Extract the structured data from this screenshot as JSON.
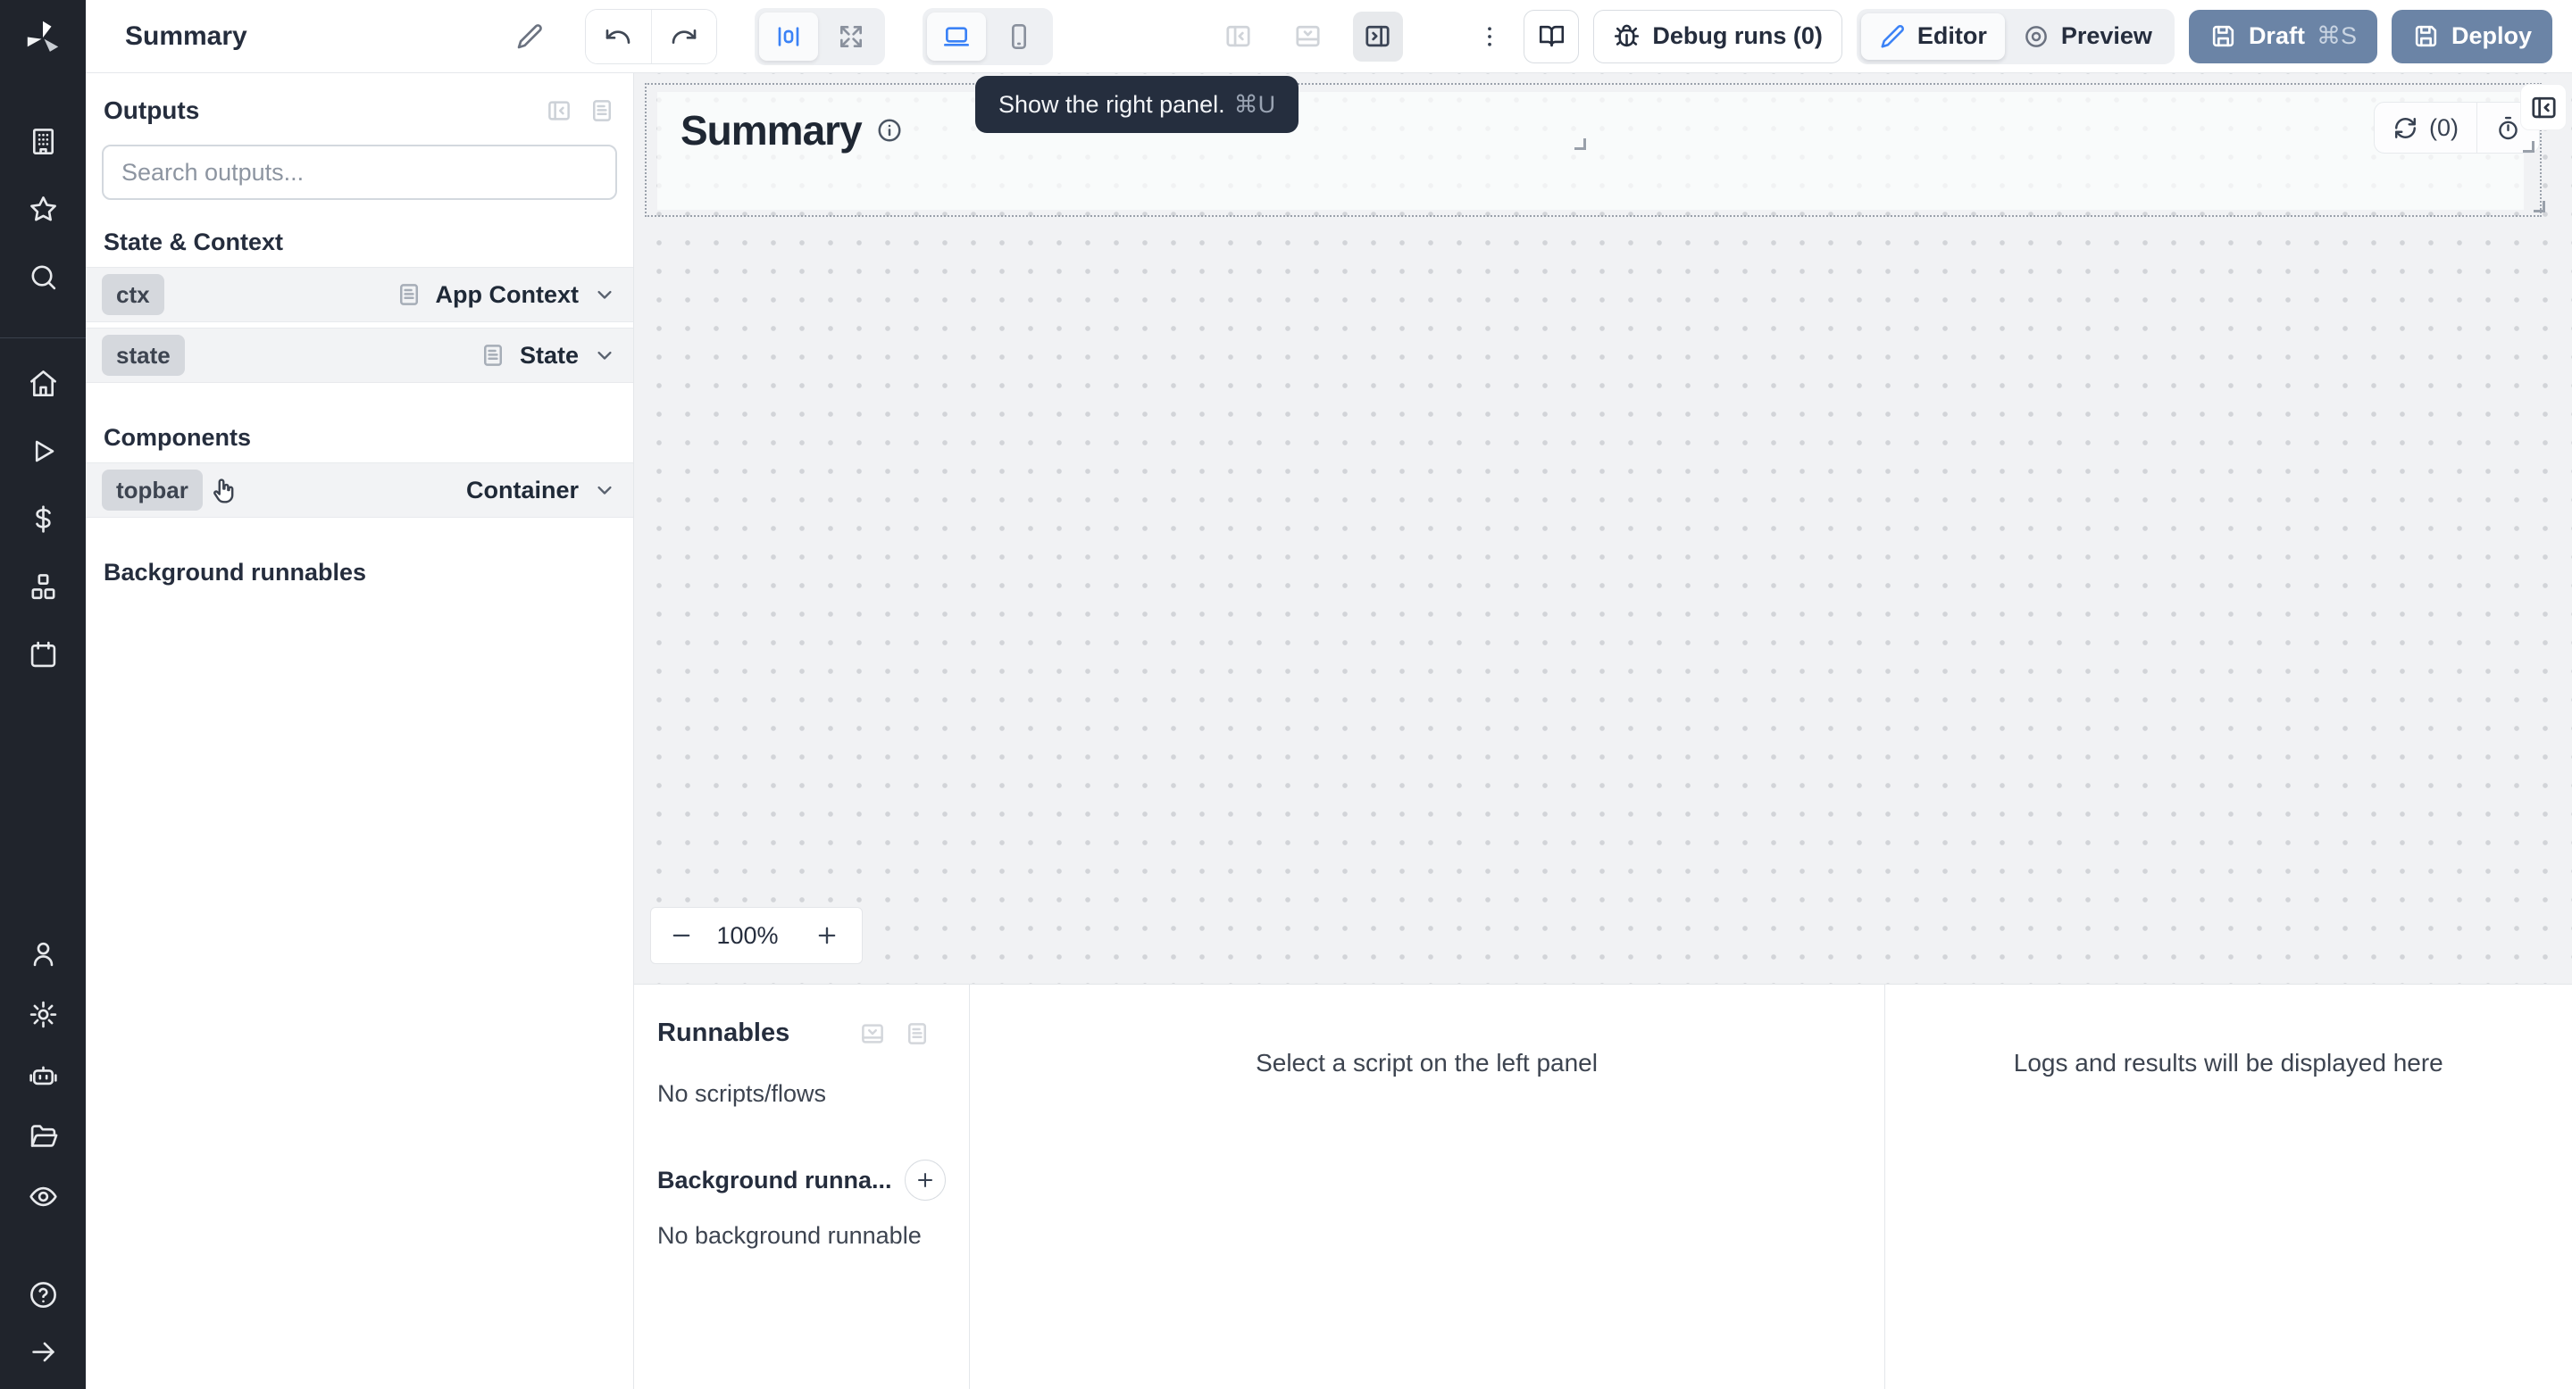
{
  "header": {
    "app_title": "Summary",
    "debug_runs": "Debug runs (0)",
    "editor": "Editor",
    "preview": "Preview",
    "draft": "Draft",
    "draft_shortcut": "⌘S",
    "deploy": "Deploy"
  },
  "tooltip": {
    "text": "Show the right panel.",
    "shortcut": "⌘U"
  },
  "outputs": {
    "title": "Outputs",
    "search_placeholder": "Search outputs...",
    "state_context_label": "State & Context",
    "components_label": "Components",
    "background_label": "Background runnables",
    "rows": [
      {
        "badge": "ctx",
        "type": "App Context"
      },
      {
        "badge": "state",
        "type": "State"
      },
      {
        "badge": "topbar",
        "type": "Container"
      }
    ]
  },
  "canvas": {
    "heading": "Summary",
    "refresh_count": "(0)",
    "zoom_out": "−",
    "zoom_level": "100%",
    "zoom_in": "+"
  },
  "runnables": {
    "title": "Runnables",
    "no_scripts": "No scripts/flows",
    "background_title": "Background runna...",
    "no_background": "No background runnable"
  },
  "panels": {
    "script_placeholder": "Select a script on the left panel",
    "logs_placeholder": "Logs and results will be displayed here"
  },
  "colors": {
    "accent_blue": "#3b82f6",
    "solid_button_slate": "#6b84a6",
    "sidebar_bg": "#20242c",
    "tooltip_bg": "#252e3e",
    "canvas_bg": "#f1f2f4"
  },
  "icons": [
    "windmill-logo",
    "building-icon",
    "star-icon",
    "search-icon",
    "home-icon",
    "play-icon",
    "dollar-icon",
    "boxes-icon",
    "calendar-icon",
    "user-icon",
    "gear-icon",
    "bot-icon",
    "folder-icon",
    "eye-icon",
    "help-icon",
    "arrow-right-icon",
    "pencil-icon",
    "undo-icon",
    "redo-icon",
    "align-center-icon",
    "expand-icon",
    "laptop-icon",
    "smartphone-icon",
    "panel-left-icon",
    "panel-bottom-icon",
    "panel-right-icon",
    "kebab-icon",
    "book-icon",
    "bug-icon",
    "preview-target-icon",
    "save-icon",
    "info-icon",
    "refresh-icon",
    "timer-icon",
    "panel-collapse-icon",
    "doc-icon",
    "chevron-down-icon",
    "minus-icon",
    "plus-icon",
    "hand-pointer-icon"
  ]
}
